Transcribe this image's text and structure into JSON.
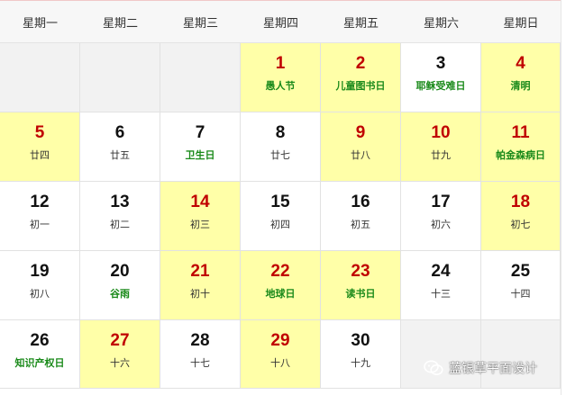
{
  "weekdays": [
    "星期一",
    "星期二",
    "星期三",
    "星期四",
    "星期五",
    "星期六",
    "星期日"
  ],
  "weeks": [
    [
      {
        "empty": true
      },
      {
        "empty": true
      },
      {
        "empty": true
      },
      {
        "day": "1",
        "sub": "愚人节",
        "festival": true,
        "red": true,
        "highlight": true
      },
      {
        "day": "2",
        "sub": "儿童图书日",
        "festival": true,
        "red": true,
        "highlight": true
      },
      {
        "day": "3",
        "sub": "耶稣受难日",
        "festival": true,
        "red": false,
        "highlight": false
      },
      {
        "day": "4",
        "sub": "清明",
        "festival": true,
        "red": true,
        "highlight": true
      }
    ],
    [
      {
        "day": "5",
        "sub": "廿四",
        "festival": false,
        "red": true,
        "highlight": true
      },
      {
        "day": "6",
        "sub": "廿五",
        "festival": false,
        "red": false,
        "highlight": false
      },
      {
        "day": "7",
        "sub": "卫生日",
        "festival": true,
        "red": false,
        "highlight": false
      },
      {
        "day": "8",
        "sub": "廿七",
        "festival": false,
        "red": false,
        "highlight": false
      },
      {
        "day": "9",
        "sub": "廿八",
        "festival": false,
        "red": true,
        "highlight": true
      },
      {
        "day": "10",
        "sub": "廿九",
        "festival": false,
        "red": true,
        "highlight": true
      },
      {
        "day": "11",
        "sub": "帕金森病日",
        "festival": true,
        "red": true,
        "highlight": true
      }
    ],
    [
      {
        "day": "12",
        "sub": "初一",
        "festival": false,
        "red": false,
        "highlight": false
      },
      {
        "day": "13",
        "sub": "初二",
        "festival": false,
        "red": false,
        "highlight": false
      },
      {
        "day": "14",
        "sub": "初三",
        "festival": false,
        "red": true,
        "highlight": true
      },
      {
        "day": "15",
        "sub": "初四",
        "festival": false,
        "red": false,
        "highlight": false
      },
      {
        "day": "16",
        "sub": "初五",
        "festival": false,
        "red": false,
        "highlight": false
      },
      {
        "day": "17",
        "sub": "初六",
        "festival": false,
        "red": false,
        "highlight": false
      },
      {
        "day": "18",
        "sub": "初七",
        "festival": false,
        "red": true,
        "highlight": true
      }
    ],
    [
      {
        "day": "19",
        "sub": "初八",
        "festival": false,
        "red": false,
        "highlight": false
      },
      {
        "day": "20",
        "sub": "谷雨",
        "festival": true,
        "red": false,
        "highlight": false
      },
      {
        "day": "21",
        "sub": "初十",
        "festival": false,
        "red": true,
        "highlight": true
      },
      {
        "day": "22",
        "sub": "地球日",
        "festival": true,
        "red": true,
        "highlight": true
      },
      {
        "day": "23",
        "sub": "读书日",
        "festival": true,
        "red": true,
        "highlight": true
      },
      {
        "day": "24",
        "sub": "十三",
        "festival": false,
        "red": false,
        "highlight": false
      },
      {
        "day": "25",
        "sub": "十四",
        "festival": false,
        "red": false,
        "highlight": false
      }
    ],
    [
      {
        "day": "26",
        "sub": "知识产权日",
        "festival": true,
        "red": false,
        "highlight": false
      },
      {
        "day": "27",
        "sub": "十六",
        "festival": false,
        "red": true,
        "highlight": true
      },
      {
        "day": "28",
        "sub": "十七",
        "festival": false,
        "red": false,
        "highlight": false
      },
      {
        "day": "29",
        "sub": "十八",
        "festival": false,
        "red": true,
        "highlight": true
      },
      {
        "day": "30",
        "sub": "十九",
        "festival": false,
        "red": false,
        "highlight": false
      },
      {
        "empty": true
      },
      {
        "empty": true
      }
    ]
  ],
  "watermark": {
    "text": "蓝银草平面设计",
    "icon": "wechat-icon"
  },
  "colors": {
    "highlight_bg": "#ffffa8",
    "empty_bg": "#f2f2f2",
    "red_day": "#c00000",
    "festival_text": "#1a8a1a",
    "header_bg": "#f7f7f7"
  }
}
